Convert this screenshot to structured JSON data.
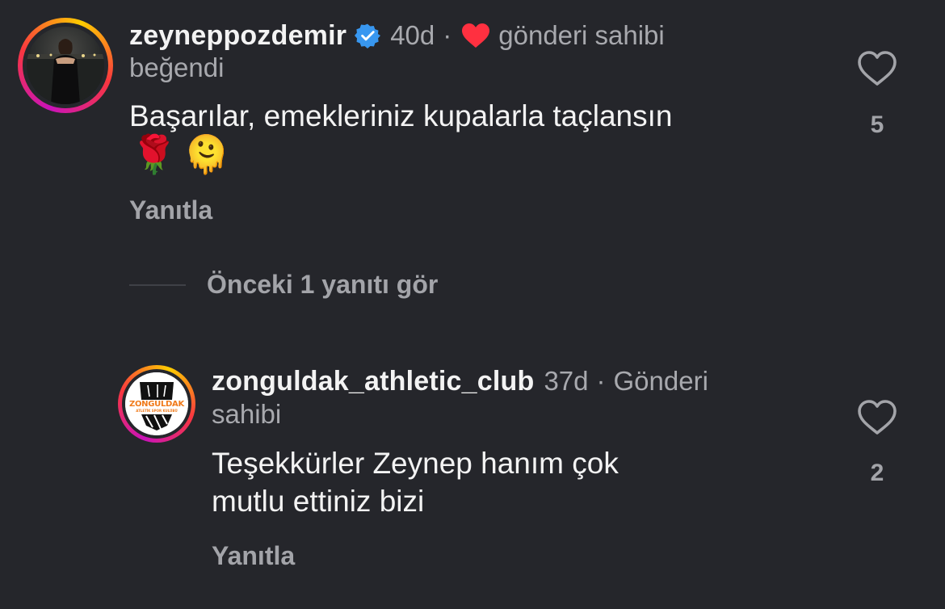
{
  "comments": [
    {
      "username": "zeyneppozdemir",
      "verified": true,
      "time": "40d",
      "separator": "·",
      "liked_by_author_text": "gönderi sahibi",
      "liked_by_author_text_line2": "beğendi",
      "text_line1": "Başarılar, emekleriniz kupalarla taçlansın",
      "emojis": [
        "🌹",
        "🫠"
      ],
      "reply_label": "Yanıtla",
      "like_count": "5",
      "icons": [
        "verified-badge-icon",
        "heart-icon",
        "heart-outline-icon"
      ]
    },
    {
      "username": "zonguldak_athletic_club",
      "time": "37d",
      "separator": "·",
      "author_label": "Gönderi",
      "author_label_line2": "sahibi",
      "text_line1": "Teşekkürler Zeynep hanım çok",
      "text_line2": "mutlu ettiniz bizi",
      "reply_label": "Yanıtla",
      "like_count": "2",
      "logo_text": "ZONGULDAK",
      "logo_subtext": "ATLETİK SPOR KULÜBÜ"
    }
  ],
  "view_previous_replies": "Önceki 1 yanıtı gör",
  "colors": {
    "background": "#25262b",
    "text_primary": "#f3f3f3",
    "text_secondary": "#a8a9ae",
    "verified_blue": "#3897f0",
    "heart_red": "#ff3040",
    "logo_orange": "#f07a1a"
  }
}
